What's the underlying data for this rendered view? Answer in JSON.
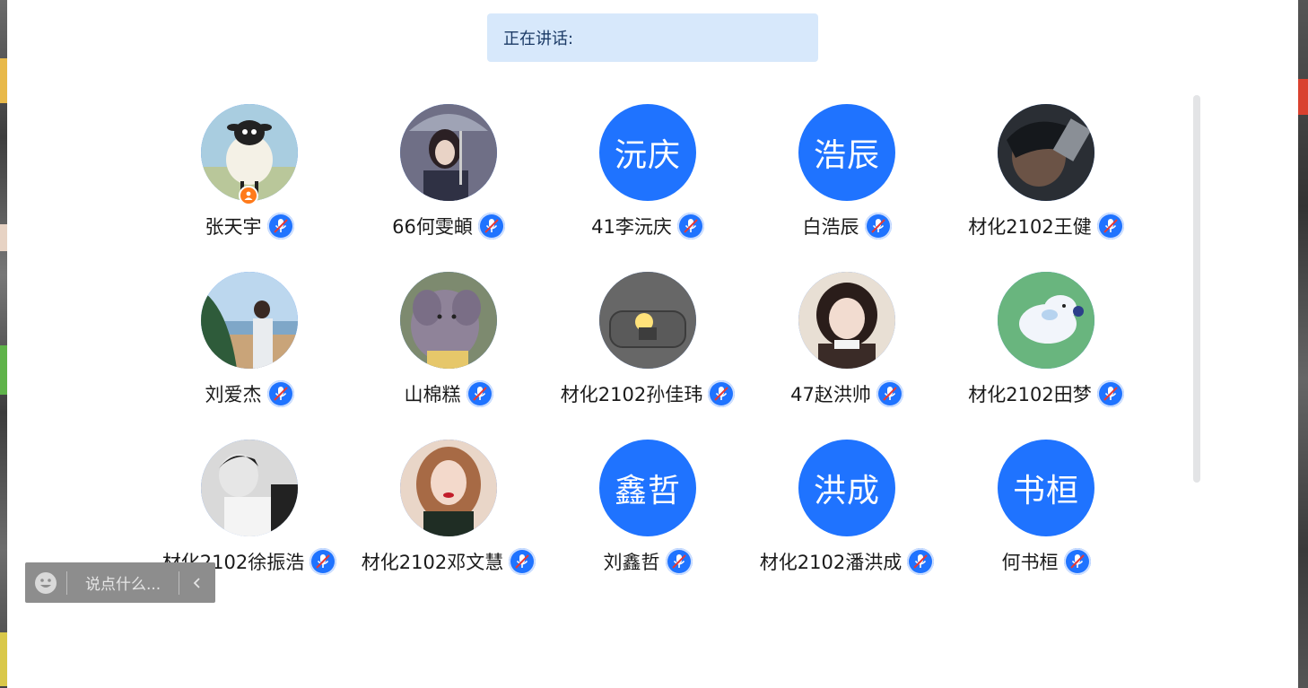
{
  "speaking": {
    "label": "正在讲话:"
  },
  "participants": [
    {
      "name": "张天宇",
      "avatar": "sheep-photo",
      "host": true
    },
    {
      "name": "66何雯頔",
      "avatar": "girl-umbrella-photo"
    },
    {
      "name": "41李沅庆",
      "initials": "沅庆"
    },
    {
      "name": "白浩辰",
      "initials": "浩辰"
    },
    {
      "name": "材化2102王健",
      "avatar": "anime-character-photo"
    },
    {
      "name": "刘爱杰",
      "avatar": "seaside-photo"
    },
    {
      "name": "山棉糕",
      "avatar": "elephant-drawing"
    },
    {
      "name": "材化2102孙佳玮",
      "avatar": "lamp-drawing"
    },
    {
      "name": "47赵洪帅",
      "avatar": "girl-photo"
    },
    {
      "name": "材化2102田梦",
      "avatar": "puppy-drawing"
    },
    {
      "name": "材化2102徐振浩",
      "avatar": "boy-bw-photo"
    },
    {
      "name": "材化2102邓文慧",
      "avatar": "girl-portrait-photo"
    },
    {
      "name": "刘鑫哲",
      "initials": "鑫哲"
    },
    {
      "name": "材化2102潘洪成",
      "initials": "洪成"
    },
    {
      "name": "何书桓",
      "initials": "书桓"
    }
  ],
  "chat": {
    "placeholder": "说点什么..."
  },
  "colors": {
    "accent": "#1f73ff",
    "speaking_bg": "#d7e8fb",
    "host_badge": "#ff7a1a"
  },
  "icons": {
    "mic": "mic-muted-icon",
    "host": "host-person-icon",
    "emoji": "emoji-icon",
    "collapse": "chevron-left-icon"
  }
}
